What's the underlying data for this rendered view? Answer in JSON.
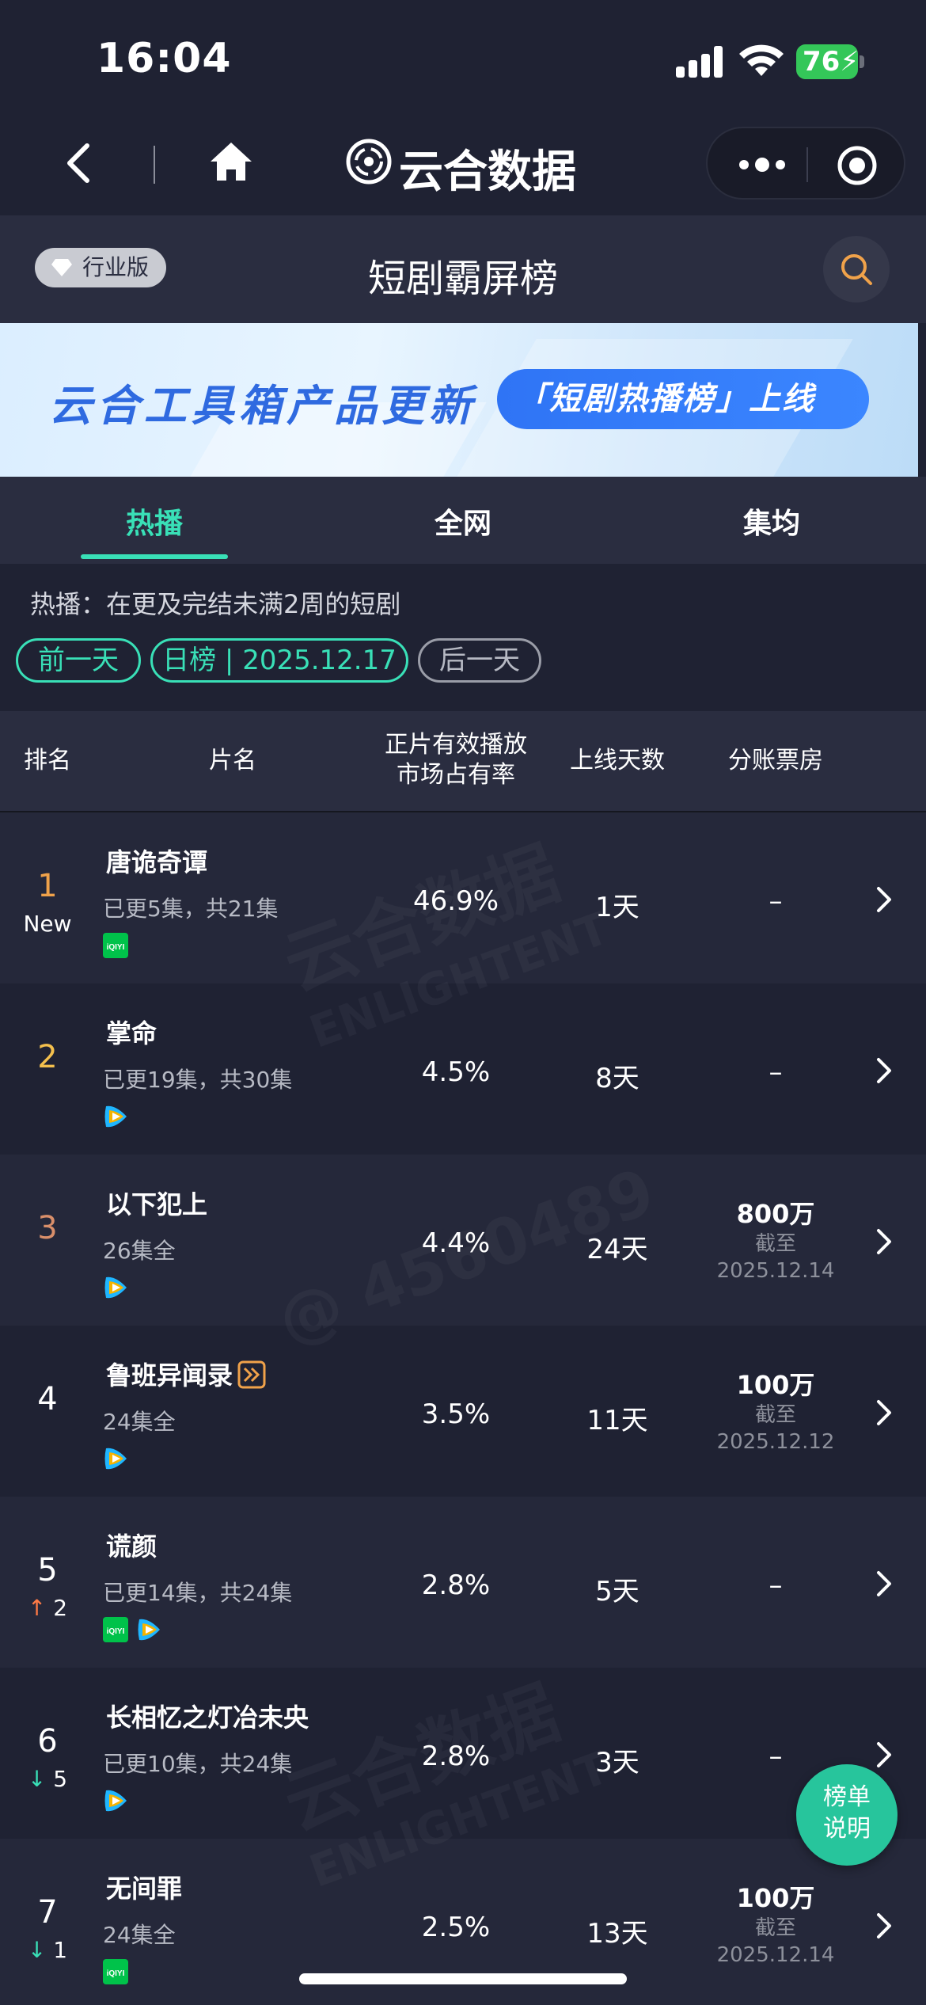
{
  "status_bar": {
    "time": "16:04",
    "battery": "76"
  },
  "navbar": {
    "app_title": "云合数据"
  },
  "page_header": {
    "edition": "行业版",
    "title": "短剧霸屏榜"
  },
  "banner": {
    "text": "云合工具箱产品更新",
    "pill": "「短剧热播榜」上线"
  },
  "tabs": [
    {
      "label": "热播",
      "active": true
    },
    {
      "label": "全网",
      "active": false
    },
    {
      "label": "集均",
      "active": false
    }
  ],
  "filter": {
    "description": "热播：在更及完结未满2周的短剧",
    "prev_day": "前一天",
    "current": "日榜 | 2025.12.17",
    "next_day": "后一天"
  },
  "table": {
    "headers": {
      "rank": "排名",
      "title": "片名",
      "share_line1": "正片有效播放",
      "share_line2": "市场占有率",
      "days": "上线天数",
      "boxoffice": "分账票房"
    },
    "rows": [
      {
        "rank": "1",
        "rank_color": "#f0a24a",
        "change": "New",
        "title": "唐诡奇谭",
        "episodes": "已更5集，共21集",
        "platforms": [
          "iqiyi"
        ],
        "share": "46.9%",
        "days": "1天",
        "boxoffice": "–",
        "bo_note1": "",
        "bo_note2": ""
      },
      {
        "rank": "2",
        "rank_color": "#f4c04d",
        "change": "",
        "title": "掌命",
        "episodes": "已更19集，共30集",
        "platforms": [
          "tencent"
        ],
        "share": "4.5%",
        "days": "8天",
        "boxoffice": "–",
        "bo_note1": "",
        "bo_note2": ""
      },
      {
        "rank": "3",
        "rank_color": "#d98f6a",
        "change": "",
        "title": "以下犯上",
        "episodes": "26集全",
        "platforms": [
          "tencent"
        ],
        "share": "4.4%",
        "days": "24天",
        "boxoffice": "800万",
        "bo_note1": "截至",
        "bo_note2": "2025.12.14"
      },
      {
        "rank": "4",
        "rank_color": "#ffffff",
        "change": "",
        "title": "鲁班异闻录",
        "episodes": "24集全",
        "platforms": [
          "tencent"
        ],
        "share": "3.5%",
        "days": "11天",
        "boxoffice": "100万",
        "bo_note1": "截至",
        "bo_note2": "2025.12.12"
      },
      {
        "rank": "5",
        "rank_color": "#ffffff",
        "change": "2",
        "change_dir": "up",
        "title": "谎颜",
        "episodes": "已更14集，共24集",
        "platforms": [
          "iqiyi",
          "tencent"
        ],
        "share": "2.8%",
        "days": "5天",
        "boxoffice": "–",
        "bo_note1": "",
        "bo_note2": ""
      },
      {
        "rank": "6",
        "rank_color": "#ffffff",
        "change": "5",
        "change_dir": "down",
        "title": "长相忆之灯冶未央",
        "episodes": "已更10集，共24集",
        "platforms": [
          "tencent"
        ],
        "share": "2.8%",
        "days": "3天",
        "boxoffice": "–",
        "bo_note1": "",
        "bo_note2": ""
      },
      {
        "rank": "7",
        "rank_color": "#ffffff",
        "change": "1",
        "change_dir": "down",
        "title": "无间罪",
        "episodes": "24集全",
        "platforms": [
          "iqiyi"
        ],
        "share": "2.5%",
        "days": "13天",
        "boxoffice": "100万",
        "bo_note1": "截至",
        "bo_note2": "2025.12.14"
      }
    ]
  },
  "watermark": {
    "brand": "云合数据",
    "brand_en": "ENLIGHTENT",
    "user": "@ 4560489"
  },
  "float_button": {
    "line1": "榜单",
    "line2": "说明"
  },
  "colors": {
    "accent": "#39e0b7",
    "background": "#1f2233",
    "panel": "#2a2d40",
    "banner_blue": "#2f6ae0"
  }
}
